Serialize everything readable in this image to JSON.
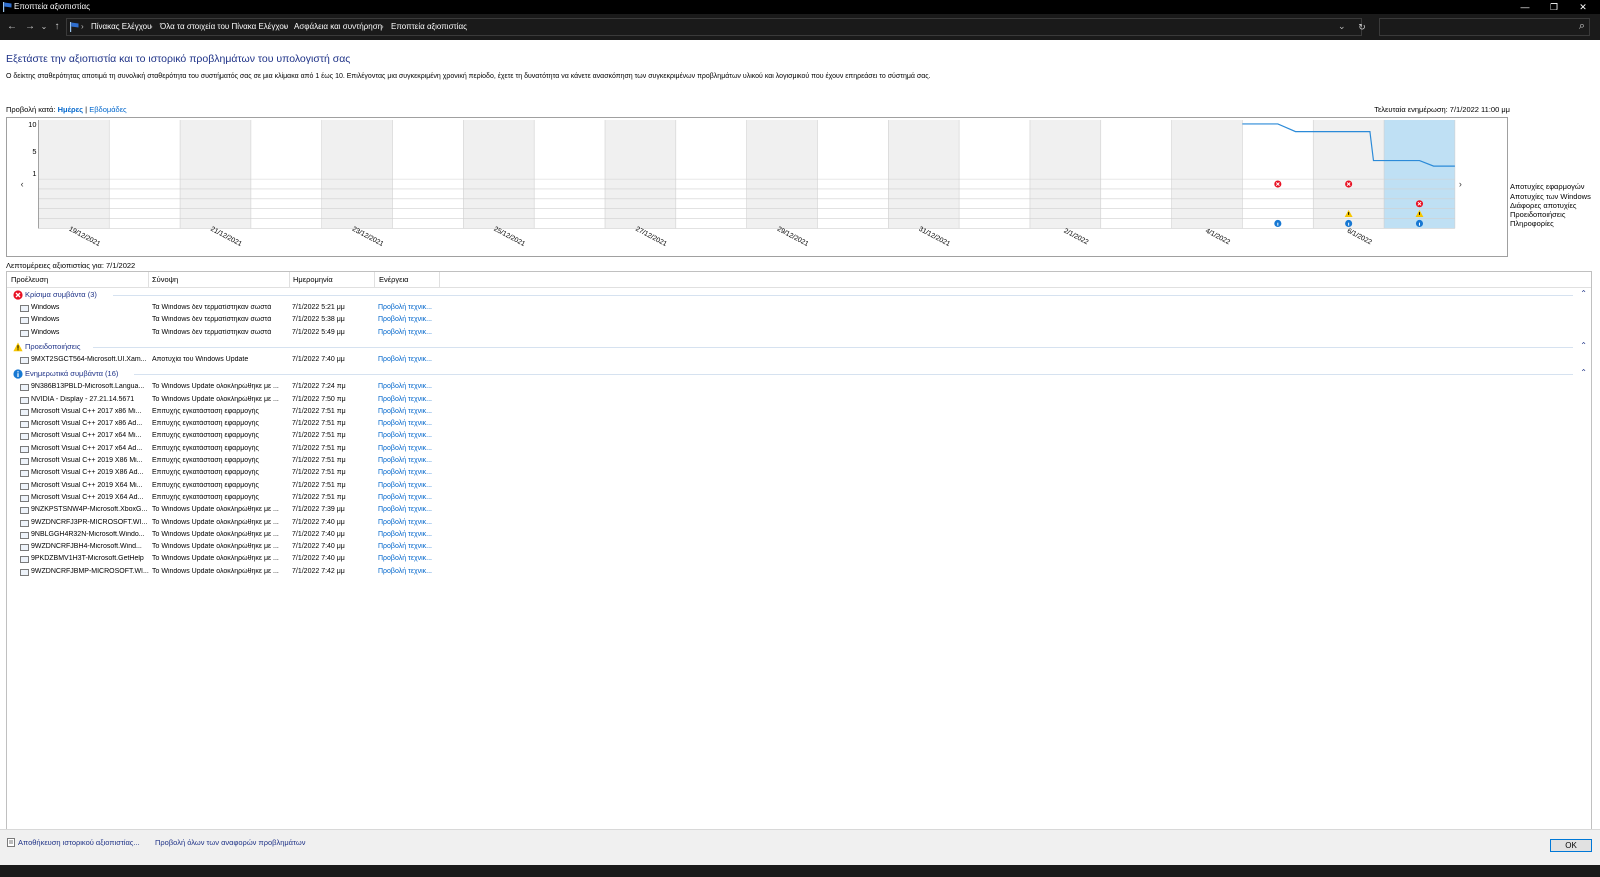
{
  "window": {
    "title": "Εποπτεία αξιοπιστίας",
    "minimize": "—",
    "restore": "❐",
    "close": "✕"
  },
  "nav": {
    "back": "←",
    "forward": "→",
    "recent": "⌄",
    "up": "↑",
    "dropdown": "⌄",
    "refresh": "↻",
    "search_icon": "⌕",
    "breadcrumbs": [
      "Πίνακας Ελέγχου",
      "Όλα τα στοιχεία του Πίνακα Ελέγχου",
      "Ασφάλεια και συντήρηση",
      "Εποπτεία αξιοπιστίας"
    ],
    "separator": "›"
  },
  "header": {
    "title": "Εξετάστε την αξιοπιστία και το ιστορικό προβλημάτων του υπολογιστή σας",
    "description": "Ο δείκτης σταθερότητας αποτιμά τη συνολική σταθερότητα του συστήματός σας σε μια κλίμακα από 1 έως 10. Επιλέγοντας μια συγκεκριμένη χρονική περίοδο, έχετε τη δυνατότητα να κάνετε ανασκόπηση των συγκεκριμένων προβλημάτων υλικού και λογισμικού που έχουν επηρεάσει το σύστημά σας.",
    "view_by_label": "Προβολή κατά:",
    "view_days": "Ημέρες",
    "view_sep": "|",
    "view_weeks": "Εβδομάδες",
    "last_update": "Τελευταία ενημέρωση: 7/1/2022 11:00 μμ"
  },
  "chart_data": {
    "type": "line",
    "y_ticks": [
      "10",
      "5",
      "1"
    ],
    "ylim": [
      1,
      10
    ],
    "x_labels": [
      "19/12/2021",
      "21/12/2021",
      "23/12/2021",
      "25/12/2021",
      "27/12/2021",
      "29/12/2021",
      "31/12/2021",
      "2/1/2022",
      "4/1/2022",
      "6/1/2022"
    ],
    "columns": 20,
    "selected_column": 19,
    "stability_line": [
      {
        "col": 17.0,
        "value": 10.0
      },
      {
        "col": 17.5,
        "value": 10.0
      },
      {
        "col": 17.75,
        "value": 8.6
      },
      {
        "col": 18.0,
        "value": 8.6
      },
      {
        "col": 18.8,
        "value": 8.6
      },
      {
        "col": 18.85,
        "value": 3.3
      },
      {
        "col": 19.5,
        "value": 3.3
      },
      {
        "col": 19.7,
        "value": 2.3
      },
      {
        "col": 20.0,
        "value": 2.3
      }
    ],
    "event_rows": [
      "Αποτυχίες εφαρμογών",
      "Αποτυχίες των Windows",
      "Διάφορες αποτυχίες",
      "Προειδοποιήσεις",
      "Πληροφορίες"
    ],
    "events": [
      {
        "col": 17,
        "row": 0,
        "kind": "error"
      },
      {
        "col": 18,
        "row": 0,
        "kind": "error"
      },
      {
        "col": 19,
        "row": 2,
        "kind": "error"
      },
      {
        "col": 18,
        "row": 3,
        "kind": "warning"
      },
      {
        "col": 19,
        "row": 3,
        "kind": "warning"
      },
      {
        "col": 17,
        "row": 4,
        "kind": "info"
      },
      {
        "col": 18,
        "row": 4,
        "kind": "info"
      },
      {
        "col": 19,
        "row": 4,
        "kind": "info"
      }
    ],
    "scroll_left": "‹",
    "scroll_right": "›",
    "colors": {
      "line": "#2b8ad8",
      "selected": "#bfe0f4",
      "shade": "#f0f0f0",
      "error": "#e81123",
      "warning": "#f7c600",
      "info": "#1778d3"
    }
  },
  "details": {
    "label": "Λεπτομέρειες αξιοπιστίας για: 7/1/2022",
    "columns": [
      "Προέλευση",
      "Σύνοψη",
      "Ημερομηνία",
      "Ενέργεια"
    ],
    "sort_indicator": "^",
    "action_label": "Προβολή τεχνικ...",
    "groups": [
      {
        "label": "Κρίσιμα συμβάντα (3)",
        "kind": "error",
        "collapse": "⌃",
        "rows": [
          {
            "source": "Windows",
            "summary": "Τα Windows δεν τερματίστηκαν σωστά",
            "date": "7/1/2022 5:21 μμ"
          },
          {
            "source": "Windows",
            "summary": "Τα Windows δεν τερματίστηκαν σωστά",
            "date": "7/1/2022 5:38 μμ"
          },
          {
            "source": "Windows",
            "summary": "Τα Windows δεν τερματίστηκαν σωστά",
            "date": "7/1/2022 5:49 μμ"
          }
        ]
      },
      {
        "label": "Προειδοποιήσεις",
        "kind": "warning",
        "collapse": "⌃",
        "rows": [
          {
            "source": "9MXT2SGCT564-Microsoft.UI.Xam...",
            "summary": "Αποτυχία του Windows Update",
            "date": "7/1/2022 7:40 μμ"
          }
        ]
      },
      {
        "label": "Ενημερωτικά συμβάντα (16)",
        "kind": "info",
        "collapse": "⌃",
        "rows": [
          {
            "source": "9N386B13PBLD-Microsoft.Langua...",
            "summary": "Το Windows Update ολοκληρώθηκε με ...",
            "date": "7/1/2022 7:24 πμ"
          },
          {
            "source": "NVIDIA - Display - 27.21.14.5671",
            "summary": "Το Windows Update ολοκληρώθηκε με ...",
            "date": "7/1/2022 7:50 πμ"
          },
          {
            "source": "Microsoft Visual C++ 2017 x86 Mi...",
            "summary": "Επιτυχής εγκατάσταση εφαρμογής",
            "date": "7/1/2022 7:51 πμ"
          },
          {
            "source": "Microsoft Visual C++ 2017 x86 Ad...",
            "summary": "Επιτυχής εγκατάσταση εφαρμογής",
            "date": "7/1/2022 7:51 πμ"
          },
          {
            "source": "Microsoft Visual C++ 2017 x64 Mi...",
            "summary": "Επιτυχής εγκατάσταση εφαρμογής",
            "date": "7/1/2022 7:51 πμ"
          },
          {
            "source": "Microsoft Visual C++ 2017 x64 Ad...",
            "summary": "Επιτυχής εγκατάσταση εφαρμογής",
            "date": "7/1/2022 7:51 πμ"
          },
          {
            "source": "Microsoft Visual C++ 2019 X86 Mi...",
            "summary": "Επιτυχής εγκατάσταση εφαρμογής",
            "date": "7/1/2022 7:51 πμ"
          },
          {
            "source": "Microsoft Visual C++ 2019 X86 Ad...",
            "summary": "Επιτυχής εγκατάσταση εφαρμογής",
            "date": "7/1/2022 7:51 πμ"
          },
          {
            "source": "Microsoft Visual C++ 2019 X64 Mi...",
            "summary": "Επιτυχής εγκατάσταση εφαρμογής",
            "date": "7/1/2022 7:51 πμ"
          },
          {
            "source": "Microsoft Visual C++ 2019 X64 Ad...",
            "summary": "Επιτυχής εγκατάσταση εφαρμογής",
            "date": "7/1/2022 7:51 πμ"
          },
          {
            "source": "9NZKPSTSNW4P-Microsoft.XboxG...",
            "summary": "Το Windows Update ολοκληρώθηκε με ...",
            "date": "7/1/2022 7:39 μμ"
          },
          {
            "source": "9WZDNCRFJ3PR-MICROSOFT.WI...",
            "summary": "Το Windows Update ολοκληρώθηκε με ...",
            "date": "7/1/2022 7:40 μμ"
          },
          {
            "source": "9NBLGGH4R32N-Microsoft.Windo...",
            "summary": "Το Windows Update ολοκληρώθηκε με ...",
            "date": "7/1/2022 7:40 μμ"
          },
          {
            "source": "9WZDNCRFJBH4-Microsoft.Wind...",
            "summary": "Το Windows Update ολοκληρώθηκε με ...",
            "date": "7/1/2022 7:40 μμ"
          },
          {
            "source": "9PKDZBMV1H3T-Microsoft.GetHelp",
            "summary": "Το Windows Update ολοκληρώθηκε με ...",
            "date": "7/1/2022 7:40 μμ"
          },
          {
            "source": "9WZDNCRFJBMP-MICROSOFT.WI...",
            "summary": "Το Windows Update ολοκληρώθηκε με ...",
            "date": "7/1/2022 7:42 μμ"
          }
        ]
      }
    ]
  },
  "footer": {
    "save_history": "Αποθήκευση ιστορικού αξιοπιστίας...",
    "view_all_reports": "Προβολή όλων των αναφορών προβλημάτων",
    "ok": "OK"
  }
}
